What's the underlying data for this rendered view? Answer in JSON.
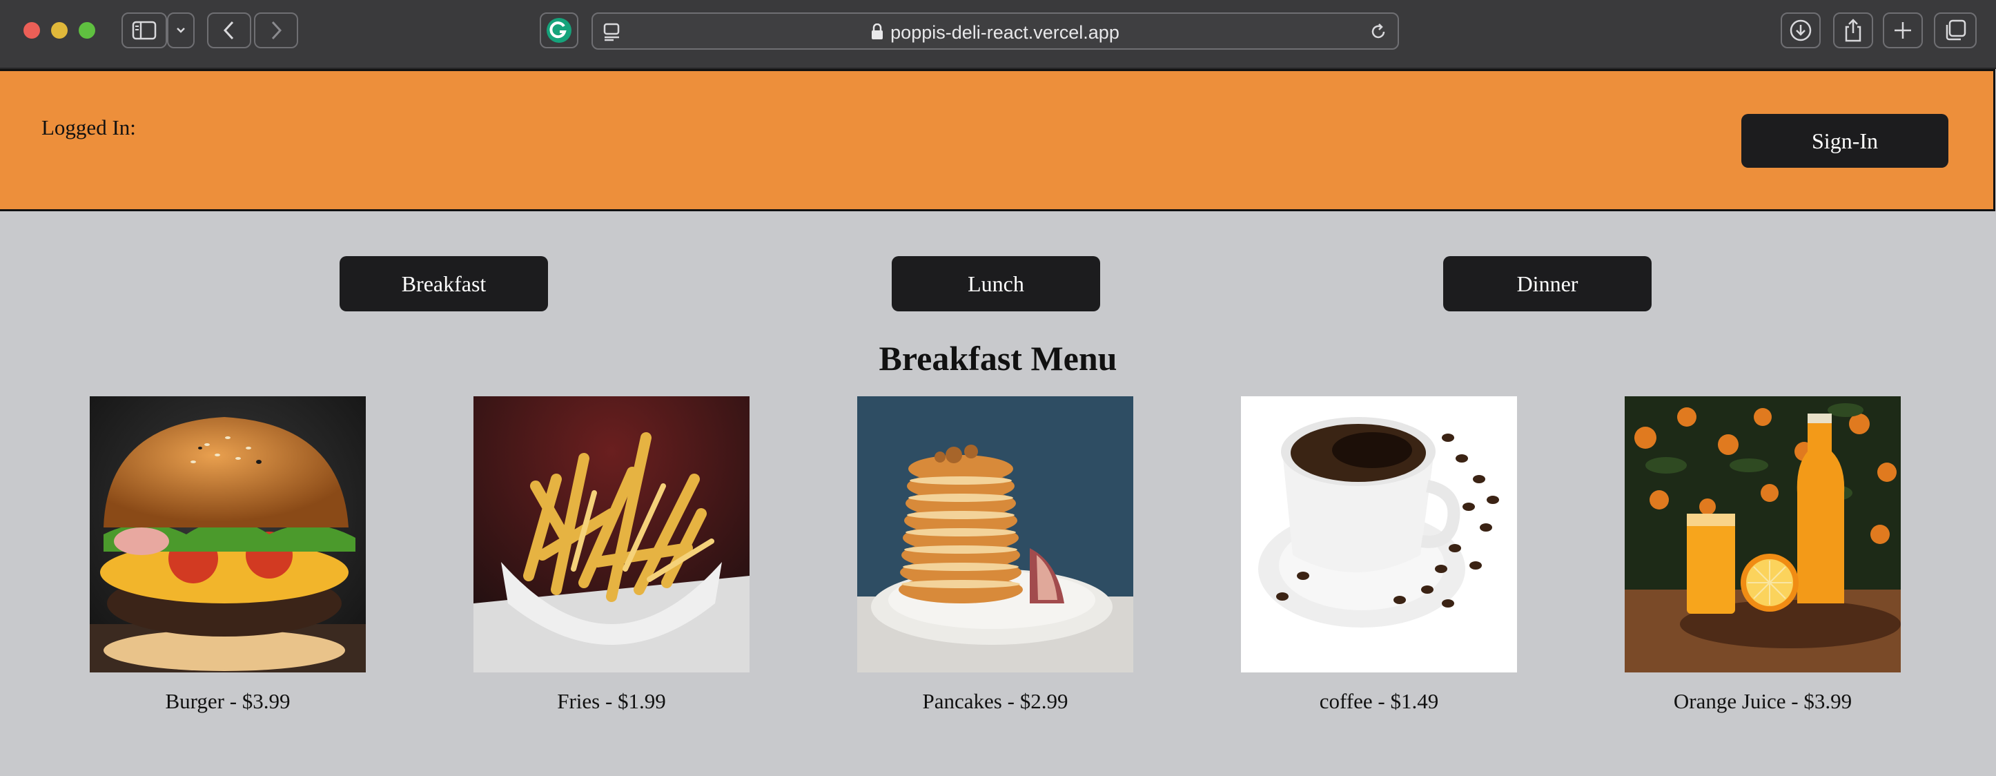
{
  "browser": {
    "url": "poppis-deli-react.vercel.app"
  },
  "header": {
    "logged_in_label": "Logged In:",
    "signin_label": "Sign-In",
    "accent_color": "#ed8f3b"
  },
  "meal_tabs": [
    {
      "label": "Breakfast"
    },
    {
      "label": "Lunch"
    },
    {
      "label": "Dinner"
    }
  ],
  "menu": {
    "title": "Breakfast Menu",
    "items": [
      {
        "label": "Burger - $3.99",
        "image": "burger-photo"
      },
      {
        "label": "Fries - $1.99",
        "image": "fries-photo"
      },
      {
        "label": "Pancakes - $2.99",
        "image": "pancakes-photo"
      },
      {
        "label": "coffee - $1.49",
        "image": "coffee-photo"
      },
      {
        "label": "Orange Juice - $3.99",
        "image": "orange-juice-photo"
      }
    ]
  }
}
